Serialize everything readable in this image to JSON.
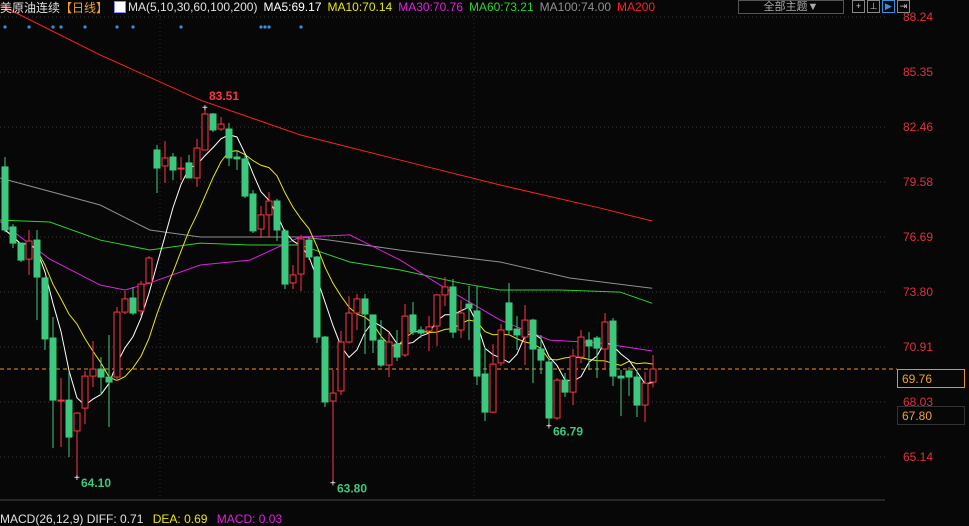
{
  "header": {
    "symbol": "美原油连续",
    "period": "【日线】",
    "ma_params": "MA(5,10,30,60,100,200)",
    "ma5": "MA5:69.17",
    "ma10": "MA10:70.14",
    "ma30": "MA30:70.76",
    "ma60": "MA60:73.21",
    "ma100": "MA100:74.00",
    "ma200": "MA200",
    "theme_button": "全部主题▼"
  },
  "toolbar_icons": [
    "plus-icon",
    "dock-icon",
    "play-icon",
    "exit-icon"
  ],
  "macd": {
    "label": "MACD(26,12,9) DIFF: 0.71",
    "dea": "DEA: 0.69",
    "macd": "MACD: 0.03"
  },
  "colors": {
    "up": "#ff3344",
    "down": "#3cc97e",
    "ma5": "#ffffff",
    "ma10": "#e8e800",
    "ma30": "#e020e0",
    "ma60": "#30d030",
    "ma100": "#909090",
    "ma200": "#ff2020",
    "current": "#f09020",
    "axis": "#e03040"
  },
  "chart_data": {
    "type": "candlestick",
    "title": "美原油连续 日线",
    "y_ticks": [
      "88.24",
      "85.35",
      "82.46",
      "79.58",
      "76.69",
      "73.80",
      "70.91",
      "68.03",
      "65.14"
    ],
    "ylim": [
      63.3,
      88.6
    ],
    "current_price": "69.76",
    "price_box2": "67.80",
    "annotations": {
      "high": {
        "index": 25,
        "label": "83.51"
      },
      "low1": {
        "index": 9,
        "label": "64.10"
      },
      "low2": {
        "index": 41,
        "label": "63.80"
      },
      "low3": {
        "index": 68,
        "label": "66.79"
      }
    },
    "event_markers": [
      0,
      3,
      6,
      7,
      10,
      14,
      16,
      22,
      32,
      32.5,
      33,
      37
    ],
    "ohlc": [
      [
        80.37,
        80.89,
        76.95,
        77.06
      ],
      [
        77.22,
        77.37,
        76.11,
        76.37
      ],
      [
        76.37,
        76.4,
        75.38,
        75.48
      ],
      [
        75.53,
        77.06,
        74.7,
        76.48
      ],
      [
        76.53,
        77.06,
        72.33,
        74.59
      ],
      [
        74.54,
        74.6,
        70.76,
        71.34
      ],
      [
        71.39,
        72.49,
        65.61,
        68.13
      ],
      [
        68.08,
        69.29,
        65.67,
        68.13
      ],
      [
        68.13,
        69.6,
        65.14,
        66.19
      ],
      [
        66.51,
        67.5,
        64.1,
        67.45
      ],
      [
        67.71,
        69.66,
        66.87,
        69.39
      ],
      [
        69.39,
        71.23,
        68.82,
        69.76
      ],
      [
        69.76,
        70.39,
        68.4,
        69.34
      ],
      [
        69.34,
        71.55,
        66.72,
        69.08
      ],
      [
        69.34,
        73.02,
        69.13,
        72.75
      ],
      [
        72.75,
        73.86,
        72.65,
        73.44
      ],
      [
        73.49,
        74.07,
        72.6,
        72.7
      ],
      [
        72.81,
        74.38,
        72.54,
        74.22
      ],
      [
        74.28,
        75.69,
        74.2,
        75.59
      ],
      [
        81.26,
        81.52,
        79.0,
        80.31
      ],
      [
        80.42,
        81.73,
        79.53,
        80.84
      ],
      [
        80.89,
        81.1,
        79.68,
        80.21
      ],
      [
        80.26,
        80.89,
        79.68,
        80.31
      ],
      [
        80.58,
        81.0,
        79.79,
        79.79
      ],
      [
        79.79,
        81.84,
        79.32,
        81.36
      ],
      [
        81.26,
        83.51,
        81.26,
        83.15
      ],
      [
        83.15,
        83.2,
        82.2,
        82.31
      ],
      [
        82.36,
        82.99,
        82.26,
        82.62
      ],
      [
        82.36,
        82.68,
        80.42,
        80.84
      ],
      [
        80.89,
        81.26,
        80.21,
        80.79
      ],
      [
        80.79,
        81.0,
        78.74,
        78.84
      ],
      [
        78.95,
        79.16,
        76.9,
        77.01
      ],
      [
        77.11,
        78.32,
        76.64,
        77.85
      ],
      [
        77.85,
        79.05,
        76.69,
        78.58
      ],
      [
        78.58,
        78.7,
        76.48,
        77.06
      ],
      [
        77.01,
        77.1,
        73.96,
        74.22
      ],
      [
        74.28,
        75.22,
        73.96,
        74.7
      ],
      [
        74.75,
        76.8,
        73.86,
        76.59
      ],
      [
        76.53,
        76.69,
        75.5,
        75.64
      ],
      [
        75.64,
        75.7,
        71.13,
        71.44
      ],
      [
        71.44,
        71.5,
        67.77,
        68.03
      ],
      [
        68.08,
        69.71,
        63.8,
        68.5
      ],
      [
        68.61,
        71.76,
        68.4,
        71.18
      ],
      [
        71.18,
        73.59,
        71.1,
        72.7
      ],
      [
        72.7,
        73.7,
        71.81,
        73.44
      ],
      [
        73.44,
        73.7,
        70.55,
        72.65
      ],
      [
        72.6,
        72.6,
        70.6,
        71.28
      ],
      [
        71.28,
        72.33,
        69.87,
        69.97
      ],
      [
        69.97,
        71.65,
        69.34,
        71.18
      ],
      [
        71.07,
        71.81,
        70.18,
        70.39
      ],
      [
        70.5,
        73.17,
        70.39,
        72.54
      ],
      [
        72.6,
        73.28,
        71.55,
        71.7
      ],
      [
        71.81,
        72.0,
        71.4,
        71.65
      ],
      [
        71.76,
        72.54,
        70.71,
        71.97
      ],
      [
        72.02,
        73.7,
        70.97,
        73.65
      ],
      [
        73.65,
        74.59,
        73.07,
        74.07
      ],
      [
        74.07,
        74.49,
        71.39,
        71.7
      ],
      [
        71.81,
        73.38,
        71.39,
        72.7
      ],
      [
        73.17,
        74.12,
        71.28,
        72.96
      ],
      [
        72.81,
        74.12,
        68.92,
        69.39
      ],
      [
        69.5,
        70.92,
        67.03,
        67.5
      ],
      [
        67.5,
        71.07,
        67.45,
        70.02
      ],
      [
        70.08,
        72.12,
        69.92,
        71.81
      ],
      [
        73.23,
        74.28,
        71.6,
        71.81
      ],
      [
        71.86,
        72.54,
        70.76,
        71.55
      ],
      [
        71.44,
        73.12,
        69.97,
        72.33
      ],
      [
        72.33,
        72.4,
        69.02,
        70.81
      ],
      [
        70.81,
        71.55,
        69.5,
        70.23
      ],
      [
        70.13,
        70.34,
        66.79,
        67.19
      ],
      [
        67.19,
        69.29,
        67.1,
        69.18
      ],
      [
        69.18,
        69.55,
        68.29,
        68.55
      ],
      [
        68.55,
        70.81,
        67.87,
        70.44
      ],
      [
        70.39,
        71.81,
        70.08,
        71.44
      ],
      [
        71.28,
        71.7,
        69.71,
        70.97
      ],
      [
        71.39,
        71.5,
        69.29,
        70.86
      ],
      [
        70.81,
        72.7,
        69.71,
        72.23
      ],
      [
        72.28,
        72.44,
        68.87,
        69.39
      ],
      [
        69.39,
        69.71,
        67.29,
        69.29
      ],
      [
        69.66,
        69.87,
        68.35,
        69.34
      ],
      [
        69.34,
        69.71,
        67.24,
        67.87
      ],
      [
        67.87,
        69.6,
        66.98,
        69.02
      ],
      [
        69.08,
        70.5,
        68.8,
        69.76
      ]
    ],
    "ma_anchors": {
      "ma200": [
        [
          -0.6,
          88.87
        ],
        [
          11.9,
          86.25
        ],
        [
          24.4,
          83.88
        ],
        [
          36.9,
          82.05
        ],
        [
          49.4,
          80.73
        ],
        [
          61.9,
          79.42
        ],
        [
          74.4,
          78.21
        ],
        [
          80.9,
          77.53
        ]
      ],
      "ma100": [
        [
          -0.6,
          79.79
        ],
        [
          11.9,
          78.37
        ],
        [
          18.1,
          77.06
        ],
        [
          24.4,
          76.69
        ],
        [
          36.9,
          76.69
        ],
        [
          40.6,
          76.53
        ],
        [
          49.4,
          76.0
        ],
        [
          61.9,
          75.38
        ],
        [
          70.6,
          74.54
        ],
        [
          80.9,
          74.0
        ]
      ],
      "ma60": [
        [
          -0.6,
          77.58
        ],
        [
          5.6,
          77.48
        ],
        [
          11.9,
          76.53
        ],
        [
          18.1,
          76.01
        ],
        [
          24.4,
          76.37
        ],
        [
          30.6,
          76.27
        ],
        [
          36.9,
          76.27
        ],
        [
          43.1,
          75.38
        ],
        [
          49.4,
          74.96
        ],
        [
          56.9,
          74.28
        ],
        [
          61.9,
          73.91
        ],
        [
          69.4,
          73.91
        ],
        [
          76.9,
          73.8
        ],
        [
          80.9,
          73.21
        ]
      ],
      "ma30": [
        [
          -0.6,
          77.5
        ],
        [
          5.6,
          75.53
        ],
        [
          11.9,
          74.17
        ],
        [
          15,
          73.91
        ],
        [
          18.1,
          74.28
        ],
        [
          24.4,
          75.22
        ],
        [
          30.6,
          75.48
        ],
        [
          36.9,
          76.69
        ],
        [
          43.1,
          76.8
        ],
        [
          49.4,
          75.48
        ],
        [
          54.4,
          74.17
        ],
        [
          61.9,
          72.33
        ],
        [
          68.1,
          71.28
        ],
        [
          74.4,
          71.13
        ],
        [
          80.9,
          70.71
        ]
      ]
    }
  }
}
